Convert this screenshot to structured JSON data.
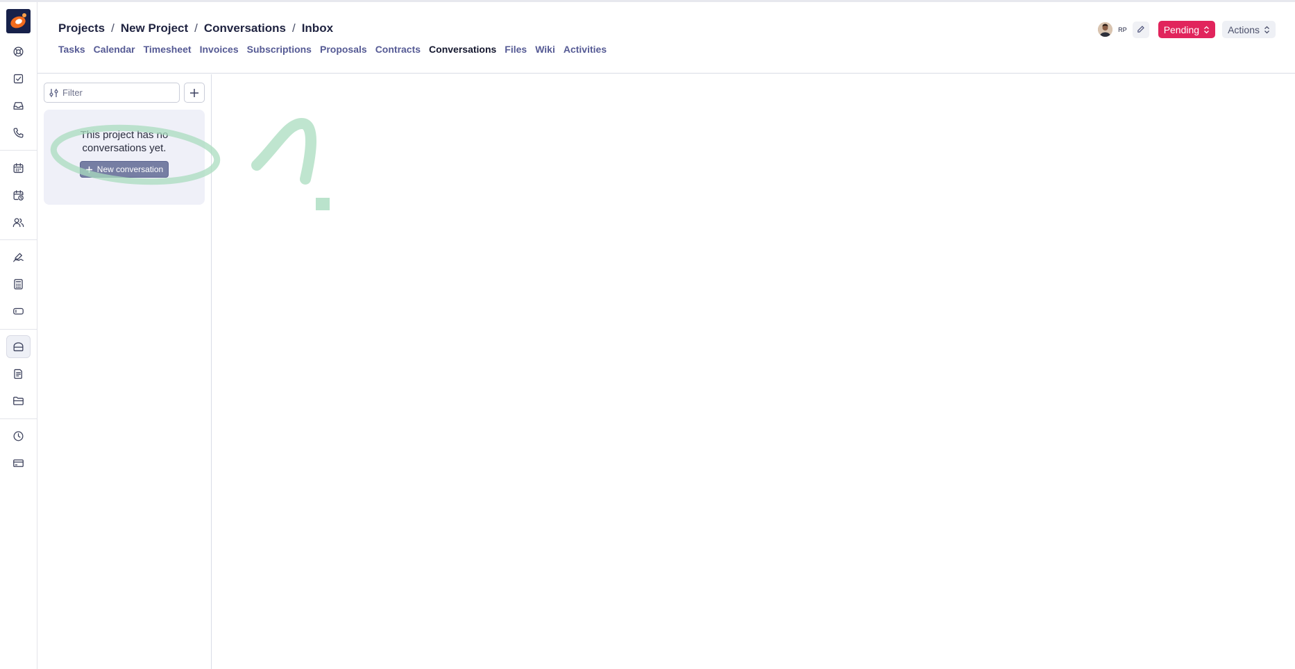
{
  "breadcrumb": {
    "items": [
      "Projects",
      "New Project",
      "Conversations",
      "Inbox"
    ],
    "separator": "/"
  },
  "subnav": {
    "tabs": [
      {
        "label": "Tasks"
      },
      {
        "label": "Calendar"
      },
      {
        "label": "Timesheet"
      },
      {
        "label": "Invoices"
      },
      {
        "label": "Subscriptions"
      },
      {
        "label": "Proposals"
      },
      {
        "label": "Contracts"
      },
      {
        "label": "Conversations",
        "active": true
      },
      {
        "label": "Files"
      },
      {
        "label": "Wiki"
      },
      {
        "label": "Activities"
      }
    ]
  },
  "header": {
    "user_initials": "RP",
    "status_label": "Pending",
    "actions_label": "Actions"
  },
  "colors": {
    "status": "#e1245c",
    "accent": "#555a94",
    "brand_logo": "#17214a",
    "annotation": "#a9dcbf"
  },
  "conversations": {
    "filter_placeholder": "Filter",
    "filter_value": "",
    "empty_message": "This project has no conversations yet.",
    "new_conversation_label": "New conversation"
  },
  "sidebar": {
    "icons": [
      "support-icon",
      "tasks-check-icon",
      "inbox-icon",
      "phone-icon",
      "calendar-icon",
      "calendar-clock-icon",
      "users-icon",
      "signature-icon",
      "calculator-icon",
      "subscription-icon",
      "projects-icon",
      "notes-icon",
      "folder-icon",
      "clock-icon",
      "card-icon"
    ],
    "active_icon": "projects-icon"
  }
}
